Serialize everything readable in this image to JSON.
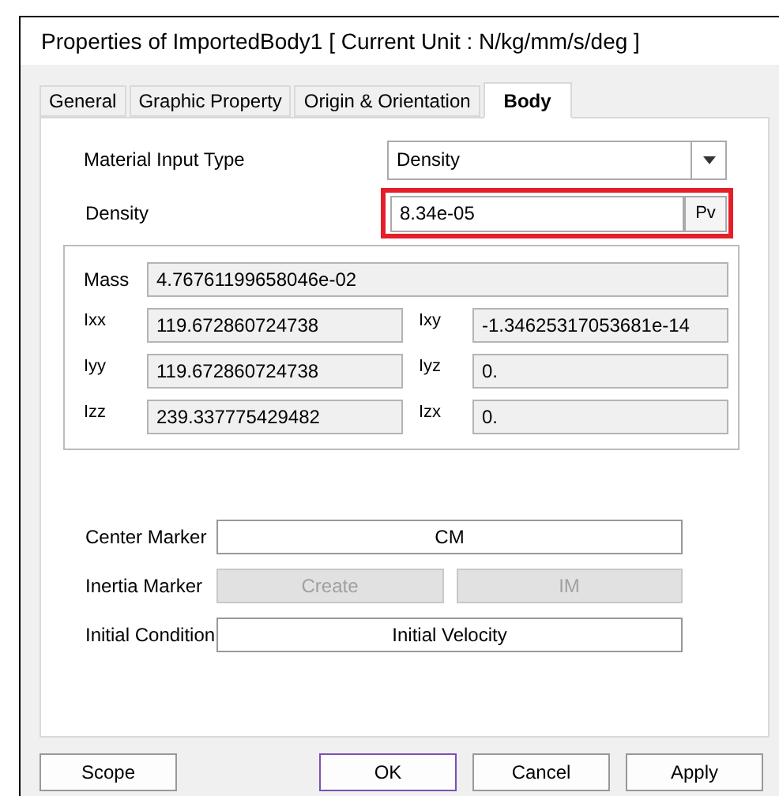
{
  "window": {
    "title": "Properties of ImportedBody1 [ Current Unit : N/kg/mm/s/deg ]"
  },
  "tabs": [
    {
      "label": "General",
      "selected": false
    },
    {
      "label": "Graphic Property",
      "selected": false
    },
    {
      "label": "Origin & Orientation",
      "selected": false
    },
    {
      "label": "Body",
      "selected": true
    }
  ],
  "material_input_type": {
    "label": "Material Input Type",
    "value": "Density"
  },
  "density": {
    "label": "Density",
    "value": "8.34e-05",
    "button": "Pv",
    "highlighted": true
  },
  "mass": {
    "label": "Mass",
    "value": "4.76761199658046e-02"
  },
  "inertia": [
    {
      "label": "Ixx",
      "value": "119.672860724738"
    },
    {
      "label": "Ixy",
      "value": "-1.34625317053681e-14"
    },
    {
      "label": "Iyy",
      "value": "119.672860724738"
    },
    {
      "label": "Iyz",
      "value": "0."
    },
    {
      "label": "Izz",
      "value": "239.337775429482"
    },
    {
      "label": "Izx",
      "value": "0."
    }
  ],
  "center_marker": {
    "label": "Center Marker",
    "buttons": [
      {
        "label": "CM",
        "disabled": false
      }
    ]
  },
  "inertia_marker": {
    "label": "Inertia Marker",
    "buttons": [
      {
        "label": "Create",
        "disabled": true
      },
      {
        "label": "IM",
        "disabled": true
      }
    ]
  },
  "initial_condition": {
    "label": "Initial Condition",
    "buttons": [
      {
        "label": "Initial Velocity",
        "disabled": false
      }
    ]
  },
  "footer_buttons": [
    {
      "label": "Scope",
      "default": false
    },
    {
      "label": "OK",
      "default": true
    },
    {
      "label": "Cancel",
      "default": false
    },
    {
      "label": "Apply",
      "default": false
    }
  ]
}
